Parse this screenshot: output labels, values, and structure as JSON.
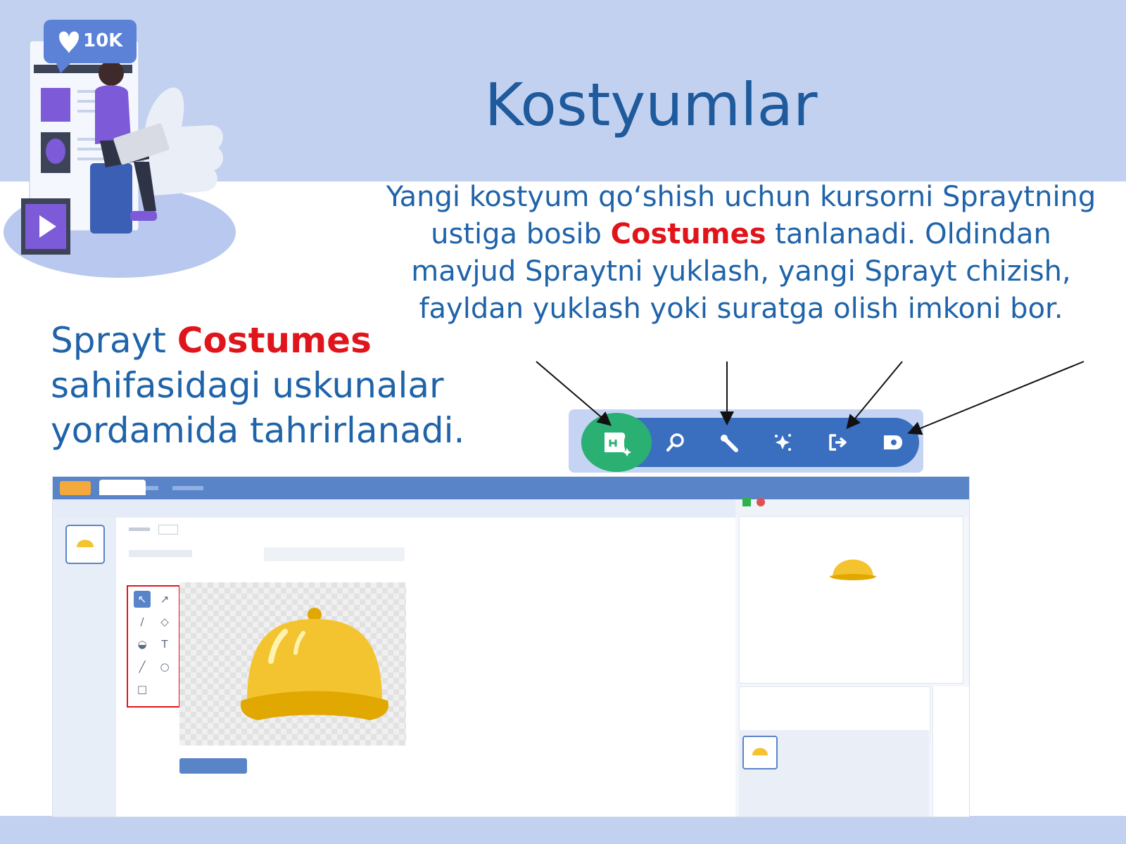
{
  "title": "Kostyumlar",
  "description": {
    "part1": "Yangi kostyum qo‘shish uchun kursorni Spraytning ustiga bosib ",
    "highlight": "Costumes",
    "part2": " tanlanadi. Oldindan mavjud Spraytni yuklash, yangi Sprayt chizish, fayldan yuklash yoki suratga  olish imkoni bor."
  },
  "left_text": {
    "part1": "Sprayt ",
    "highlight": "Costumes",
    "part2": " sahifasidagi uskunalar yordamida tahrirlanadi."
  },
  "illustration": {
    "like_count": "10K",
    "icons": [
      "heart-icon",
      "play-icon",
      "thumbs-up-icon"
    ]
  },
  "toolbar": {
    "buttons": [
      "choose-costume-icon",
      "search-icon",
      "paint-brush-icon",
      "surprise-icon",
      "upload-icon",
      "camera-icon"
    ]
  },
  "colors": {
    "band": "#c3d1f0",
    "title": "#1e5a9c",
    "text": "#1f63a9",
    "highlight": "#e0151b",
    "toolbar_bar": "#3a6fc0",
    "toolbar_green": "#2ab073"
  },
  "editor": {
    "tools": [
      "select-icon",
      "reshape-icon",
      "brush-icon",
      "eraser-icon",
      "fill-icon",
      "text-icon",
      "line-icon",
      "circle-icon",
      "rectangle-icon"
    ]
  }
}
